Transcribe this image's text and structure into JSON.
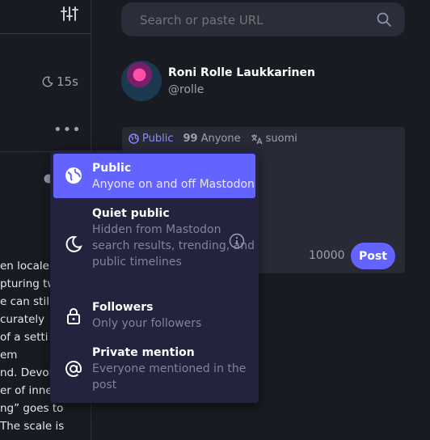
{
  "left_column": {
    "time_label": "15s",
    "more_label": "•••",
    "post_lines": [
      "en locale,",
      "pturing tw",
      "e can still",
      "curately",
      " of a setti",
      "em",
      "nd. Devoi",
      "er of inne",
      "ng” goes to",
      "The scale is"
    ]
  },
  "search": {
    "placeholder": "Search or paste URL"
  },
  "profile": {
    "display_name": "Roni Rolle Laukkarinen",
    "username": "@rolle"
  },
  "composer": {
    "visibility_label": "Public",
    "quote_label": "Anyone",
    "language_label": "suomi",
    "char_count": "10000",
    "post_label": "Post"
  },
  "visibility_menu": {
    "options": [
      {
        "title": "Public",
        "description": "Anyone on and off Mastodon"
      },
      {
        "title": "Quiet public",
        "description": "Hidden from Mastodon search results, trending, and public timelines"
      },
      {
        "title": "Followers",
        "description": "Only your followers"
      },
      {
        "title": "Private mention",
        "description": "Everyone mentioned in the post"
      }
    ]
  },
  "colors": {
    "accent": "#6364ff",
    "accent_text": "#8c8dff",
    "menu_bg": "#23233d",
    "page_bg": "#191b22"
  }
}
